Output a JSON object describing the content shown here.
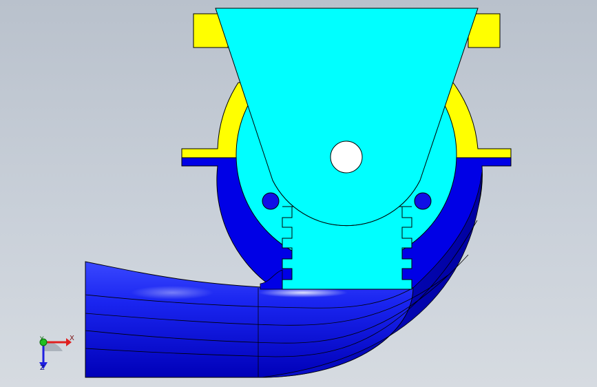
{
  "viewport": {
    "background_top": "#b9c1cc",
    "background_bottom": "#d6dbe1"
  },
  "model_colors": {
    "cyan_part": "#00ffff",
    "yellow_part": "#ffff00",
    "blue_part": "#0000e6",
    "blue_highlight": "#5a6bff",
    "edge": "#000000"
  },
  "triad": {
    "x_label": "X",
    "y_label": "Y",
    "z_label": "Z",
    "x_color": "#e02020",
    "y_color": "#20c020",
    "z_color": "#2020e0",
    "icons": [
      "axis-triad-icon"
    ]
  }
}
